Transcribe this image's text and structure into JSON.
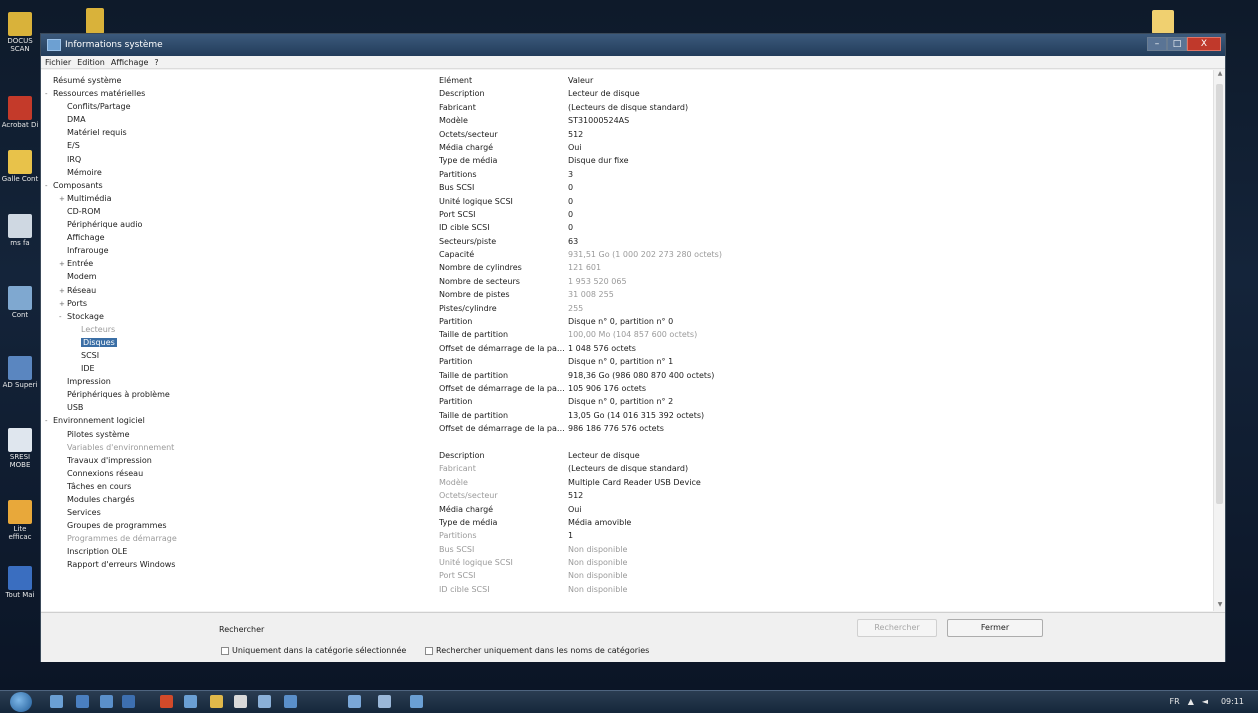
{
  "desktop": {
    "icons": [
      {
        "label": "DOCUS SCAN",
        "color": "#d9b23a"
      },
      {
        "label": "Acrobat Di",
        "color": "#c43a2a"
      },
      {
        "label": "Galle Cont",
        "color": "#e8c24a"
      },
      {
        "label": "ms fa",
        "color": "#cfd8e2"
      },
      {
        "label": "Cont",
        "color": "#7fa8d0"
      },
      {
        "label": "AD Superi",
        "color": "#5a86c0"
      },
      {
        "label": "SRESI MOBE",
        "color": "#dfe6ee"
      },
      {
        "label": "Lite efficac",
        "color": "#e8a83a"
      },
      {
        "label": "Tout Mai",
        "color": "#3a6ec0"
      }
    ],
    "top_folder_color": "#d9b23a",
    "right_icon_color": "#f0d070"
  },
  "window": {
    "title": "Informations système",
    "menu": [
      "Fichier",
      "Edition",
      "Affichage",
      "?"
    ],
    "controls": {
      "minimize": "–",
      "maximize": "□",
      "close": "X"
    }
  },
  "tree": [
    {
      "label": "Résumé système",
      "level": 0,
      "exp": ""
    },
    {
      "label": "Ressources matérielles",
      "level": 0,
      "exp": "-"
    },
    {
      "label": "Conflits/Partage",
      "level": 1,
      "exp": ""
    },
    {
      "label": "DMA",
      "level": 1,
      "exp": ""
    },
    {
      "label": "Matériel requis",
      "level": 1,
      "exp": ""
    },
    {
      "label": "E/S",
      "level": 1,
      "exp": ""
    },
    {
      "label": "IRQ",
      "level": 1,
      "exp": ""
    },
    {
      "label": "Mémoire",
      "level": 1,
      "exp": ""
    },
    {
      "label": "Composants",
      "level": 0,
      "exp": "-"
    },
    {
      "label": "Multimédia",
      "level": 1,
      "exp": "+"
    },
    {
      "label": "CD-ROM",
      "level": 1,
      "exp": ""
    },
    {
      "label": "Périphérique audio",
      "level": 1,
      "exp": ""
    },
    {
      "label": "Affichage",
      "level": 1,
      "exp": ""
    },
    {
      "label": "Infrarouge",
      "level": 1,
      "exp": ""
    },
    {
      "label": "Entrée",
      "level": 1,
      "exp": "+"
    },
    {
      "label": "Modem",
      "level": 1,
      "exp": ""
    },
    {
      "label": "Réseau",
      "level": 1,
      "exp": "+"
    },
    {
      "label": "Ports",
      "level": 1,
      "exp": "+"
    },
    {
      "label": "Stockage",
      "level": 1,
      "exp": "-"
    },
    {
      "label": "Lecteurs",
      "level": 2,
      "exp": "",
      "dim": true
    },
    {
      "label": "Disques",
      "level": 2,
      "exp": "",
      "selected": true
    },
    {
      "label": "SCSI",
      "level": 2,
      "exp": ""
    },
    {
      "label": "IDE",
      "level": 2,
      "exp": ""
    },
    {
      "label": "Impression",
      "level": 1,
      "exp": ""
    },
    {
      "label": "Périphériques à problème",
      "level": 1,
      "exp": ""
    },
    {
      "label": "USB",
      "level": 1,
      "exp": ""
    },
    {
      "label": "Environnement logiciel",
      "level": 0,
      "exp": "-"
    },
    {
      "label": "Pilotes système",
      "level": 1,
      "exp": ""
    },
    {
      "label": "Variables d'environnement",
      "level": 1,
      "exp": "",
      "dim": true
    },
    {
      "label": "Travaux d'impression",
      "level": 1,
      "exp": ""
    },
    {
      "label": "Connexions réseau",
      "level": 1,
      "exp": ""
    },
    {
      "label": "Tâches en cours",
      "level": 1,
      "exp": ""
    },
    {
      "label": "Modules chargés",
      "level": 1,
      "exp": ""
    },
    {
      "label": "Services",
      "level": 1,
      "exp": ""
    },
    {
      "label": "Groupes de programmes",
      "level": 1,
      "exp": ""
    },
    {
      "label": "Programmes de démarrage",
      "level": 1,
      "exp": "",
      "dim": true
    },
    {
      "label": "Inscription OLE",
      "level": 1,
      "exp": ""
    },
    {
      "label": "Rapport d'erreurs Windows",
      "level": 1,
      "exp": ""
    }
  ],
  "table": {
    "headers": {
      "element": "Elément",
      "value": "Valeur"
    },
    "rows": [
      {
        "k": "Description",
        "v": "Lecteur de disque"
      },
      {
        "k": "Fabricant",
        "v": "(Lecteurs de disque standard)"
      },
      {
        "k": "Modèle",
        "v": "ST31000524AS"
      },
      {
        "k": "Octets/secteur",
        "v": "512"
      },
      {
        "k": "Média chargé",
        "v": "Oui"
      },
      {
        "k": "Type de média",
        "v": "Disque dur fixe"
      },
      {
        "k": "Partitions",
        "v": "3"
      },
      {
        "k": "Bus SCSI",
        "v": "0"
      },
      {
        "k": "Unité logique SCSI",
        "v": "0"
      },
      {
        "k": "Port SCSI",
        "v": "0"
      },
      {
        "k": "ID cible SCSI",
        "v": "0"
      },
      {
        "k": "Secteurs/piste",
        "v": "63"
      },
      {
        "k": "Capacité",
        "v": "931,51 Go (1 000 202 273 280 octets)",
        "dimv": true
      },
      {
        "k": "Nombre de cylindres",
        "v": "121 601",
        "dimv": true
      },
      {
        "k": "Nombre de secteurs",
        "v": "1 953 520 065",
        "dimv": true
      },
      {
        "k": "Nombre de pistes",
        "v": "31 008 255",
        "dimv": true
      },
      {
        "k": "Pistes/cylindre",
        "v": "255",
        "dimv": true
      },
      {
        "k": "Partition",
        "v": "Disque n° 0, partition n° 0"
      },
      {
        "k": "Taille de partition",
        "v": "100,00 Mo (104 857 600 octets)",
        "dimv": true
      },
      {
        "k": "Offset de démarrage de la par...",
        "v": "1 048 576 octets"
      },
      {
        "k": "Partition",
        "v": "Disque n° 0, partition n° 1"
      },
      {
        "k": "Taille de partition",
        "v": "918,36 Go (986 080 870 400 octets)"
      },
      {
        "k": "Offset de démarrage de la par...",
        "v": "105 906 176 octets"
      },
      {
        "k": "Partition",
        "v": "Disque n° 0, partition n° 2"
      },
      {
        "k": "Taille de partition",
        "v": "13,05 Go (14 016 315 392 octets)"
      },
      {
        "k": "Offset de démarrage de la par...",
        "v": "986 186 776 576 octets"
      },
      {
        "k": "",
        "v": "",
        "blank": true
      },
      {
        "k": "Description",
        "v": "Lecteur de disque"
      },
      {
        "k": "Fabricant",
        "v": "(Lecteurs de disque standard)",
        "dimk": true
      },
      {
        "k": "Modèle",
        "v": "Multiple Card  Reader USB Device",
        "dimk": true
      },
      {
        "k": "Octets/secteur",
        "v": "512",
        "dimk": true
      },
      {
        "k": "Média chargé",
        "v": "Oui"
      },
      {
        "k": "Type de média",
        "v": "Média amovible"
      },
      {
        "k": "Partitions",
        "v": "1",
        "dimk": true
      },
      {
        "k": "Bus SCSI",
        "v": "Non disponible",
        "dim": true
      },
      {
        "k": "Unité logique SCSI",
        "v": "Non disponible",
        "dim": true
      },
      {
        "k": "Port SCSI",
        "v": "Non disponible",
        "dim": true
      },
      {
        "k": "ID cible SCSI",
        "v": "Non disponible",
        "dim": true
      }
    ]
  },
  "search": {
    "label": "Rechercher",
    "value": "",
    "find_button": "Rechercher",
    "close_button": "Fermer",
    "option_selected_category": "Uniquement dans la catégorie sélectionnée",
    "option_category_names": "Rechercher uniquement dans les noms de catégories"
  },
  "taskbar": {
    "icon_colors": [
      "#6a9fd4",
      "#4a7fc0",
      "#5a8fca",
      "#3d6fb0",
      "#d24a2a",
      "#6a9fd4",
      "#e0b84a",
      "#d9d9d9",
      "#8ab0d8",
      "#5a8fca",
      "#7aa7d8",
      "#9ab7d8",
      "#6a9fd4"
    ],
    "tray_lang": "FR",
    "clock": "09:11"
  }
}
